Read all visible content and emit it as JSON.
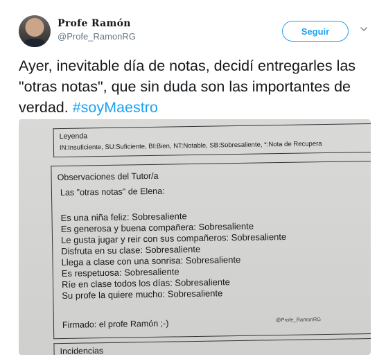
{
  "user": {
    "display_name": "Profe Ramón",
    "handle": "@Profe_RamonRG",
    "avatar_icon": "profile-photo"
  },
  "follow_label": "Seguir",
  "more_icon": "chevron-down-icon",
  "tweet": {
    "text": "Ayer, inevitable día de notas, decidí entregarles las \"otras notas\", que sin duda son las importantes de verdad.",
    "hashtag": "#soyMaestro"
  },
  "photo": {
    "legend_title": "Leyenda",
    "legend_text": "IN:Insuficiente, SU:Suficiente, BI:Bien, NT:Notable, SB:Sobresaliente, *:Nota de Recupera",
    "obs_title": "Observaciones del Tutor/a",
    "obs_subtitle": "Las \"otras notas\" de Elena:",
    "obs_items": [
      "Es una niña feliz: Sobresaliente",
      "Es generosa y buena compañera: Sobresaliente",
      "Le gusta jugar y reir con sus compañeros: Sobresaliente",
      "Disfruta en su clase: Sobresaliente",
      "Llega a clase con una sonrisa: Sobresaliente",
      "Es respetuosa: Sobresaliente",
      "Ríe en clase todos los días: Sobresaliente",
      "Su profe la quiere mucho: Sobresaliente"
    ],
    "signed": "Firmado: el profe Ramón ;-)",
    "watermark": "@Profe_RamonRG",
    "incidencias": "Incidencias"
  },
  "colors": {
    "link_blue": "#1da1f2",
    "text": "#14171a",
    "secondary": "#657786"
  }
}
